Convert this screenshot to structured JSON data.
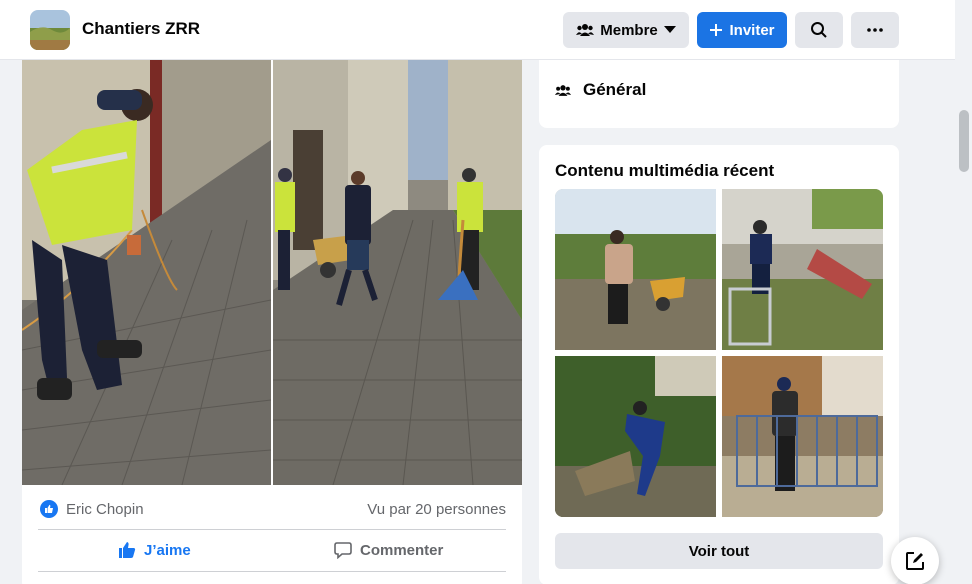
{
  "header": {
    "group_name": "Chantiers ZRR",
    "member_label": "Membre",
    "invite_label": "Inviter"
  },
  "post": {
    "reactor_name": "Eric Chopin",
    "seen_text": "Vu par 20 personnes",
    "like_label": "J’aime",
    "comment_label": "Commenter"
  },
  "sidebar": {
    "general_label": "Général",
    "media_title": "Contenu multimédia récent",
    "see_all_label": "Voir tout"
  },
  "colors": {
    "accent": "#1877f2",
    "invite_bg": "#1b74e4",
    "page_bg": "#f0f2f5"
  }
}
